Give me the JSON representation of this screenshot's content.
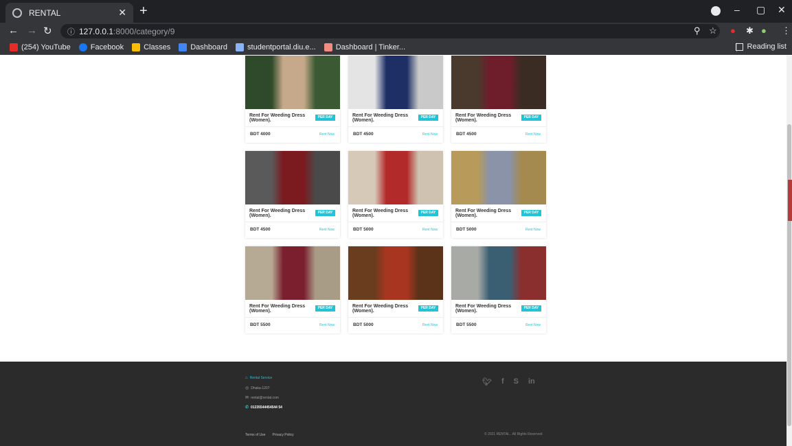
{
  "browser": {
    "tab_title": "RENTAL",
    "url_host": "127.0.0.1",
    "url_rest": ":8000/category/9",
    "bookmarks": [
      {
        "label": "(254) YouTube",
        "color": "#e52d27"
      },
      {
        "label": "Facebook",
        "color": "#1877f2"
      },
      {
        "label": "Classes",
        "color": "#fbbc04"
      },
      {
        "label": "Dashboard",
        "color": "#4285f4"
      },
      {
        "label": "studentportal.diu.e...",
        "color": "#8ab4f8"
      },
      {
        "label": "Dashboard | Tinker...",
        "color": "#f28b82"
      }
    ],
    "reading_list": "Reading list"
  },
  "products": [
    {
      "title": "Rent For Weeding Dress (Women).",
      "badge": "PER DAY",
      "price": "BDT 4000",
      "action": "Rent Now",
      "colors": [
        "#2f4a2a",
        "#c5a98a",
        "#3b5a34"
      ]
    },
    {
      "title": "Rent For Weeding Dress (Women).",
      "badge": "PER DAY",
      "price": "BDT 4500",
      "action": "Rent Now",
      "colors": [
        "#e4e4e4",
        "#1e2f66",
        "#c9c9c9"
      ]
    },
    {
      "title": "Rent For Weeding Dress (Women).",
      "badge": "PER DAY",
      "price": "BDT 4500",
      "action": "Rent Now",
      "colors": [
        "#4a3a2e",
        "#6e1d2a",
        "#3a2c23"
      ]
    },
    {
      "title": "Rent For Weeding Dress (Women).",
      "badge": "PER DAY",
      "price": "BDT 4500",
      "action": "Rent Now",
      "colors": [
        "#5a5a5a",
        "#7b1a1f",
        "#4a4a4a"
      ]
    },
    {
      "title": "Rent For Weeding Dress (Women).",
      "badge": "PER DAY",
      "price": "BDT 5000",
      "action": "Rent Now",
      "colors": [
        "#d6c9b8",
        "#b32a2a",
        "#cfc2b0"
      ]
    },
    {
      "title": "Rent For Weeding Dress (Women).",
      "badge": "PER DAY",
      "price": "BDT 5000",
      "action": "Rent Now",
      "colors": [
        "#b89a5a",
        "#8a93a8",
        "#a48a4e"
      ]
    },
    {
      "title": "Rent For Weeding Dress (Women).",
      "badge": "PER DAY",
      "price": "BDT 5500",
      "action": "Rent Now",
      "colors": [
        "#b7aa94",
        "#7b1f2e",
        "#a89c86"
      ]
    },
    {
      "title": "Rent For Weeding Dress (Women).",
      "badge": "PER DAY",
      "price": "BDT 5000",
      "action": "Rent Now",
      "colors": [
        "#6a3d1f",
        "#a8351f",
        "#5a3318"
      ]
    },
    {
      "title": "Rent For Weeding Dress (Women).",
      "badge": "PER DAY",
      "price": "BDT 5500",
      "action": "Rent Now",
      "colors": [
        "#a8aaa6",
        "#3a5f73",
        "#8b2e2e"
      ]
    }
  ],
  "footer": {
    "brand": "Rental Service",
    "address": "Dhaka-1207",
    "email": "rental@rental.com",
    "phone": "01235544454544 54",
    "terms": "Terms of Use",
    "privacy": "Privacy Policy",
    "copyright": "© 2021 RENTAL . All Rights Reserved"
  }
}
